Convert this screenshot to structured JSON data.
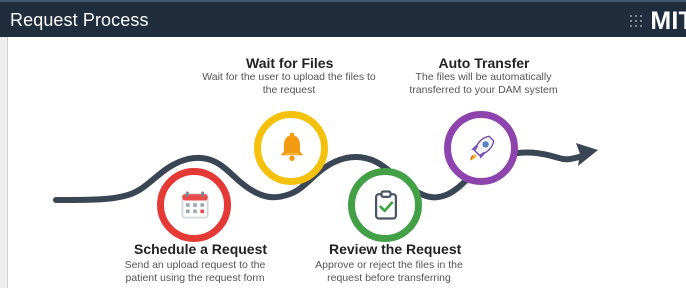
{
  "header": {
    "title": "Request Process",
    "logo_text": "MIT",
    "logo_icon": "dot-grid-icon"
  },
  "process": {
    "steps": [
      {
        "title": "Schedule a Request",
        "description": "Send an upload request to the\npatient using the request form",
        "icon": "calendar-icon",
        "color": "#e53935"
      },
      {
        "title": "Wait for Files",
        "description": "Wait for the user to upload the files to\nthe request",
        "icon": "bell-icon",
        "color": "#f4c20d"
      },
      {
        "title": "Review the Request",
        "description": "Approve or reject the files in the\nrequest before transferring",
        "icon": "clipboard-check-icon",
        "color": "#43a047"
      },
      {
        "title": "Auto Transfer",
        "description": "The files will be automatically\ntransferred to your DAM system",
        "icon": "rocket-icon",
        "color": "#8e44ad"
      }
    ],
    "path_color": "#3b4654"
  }
}
